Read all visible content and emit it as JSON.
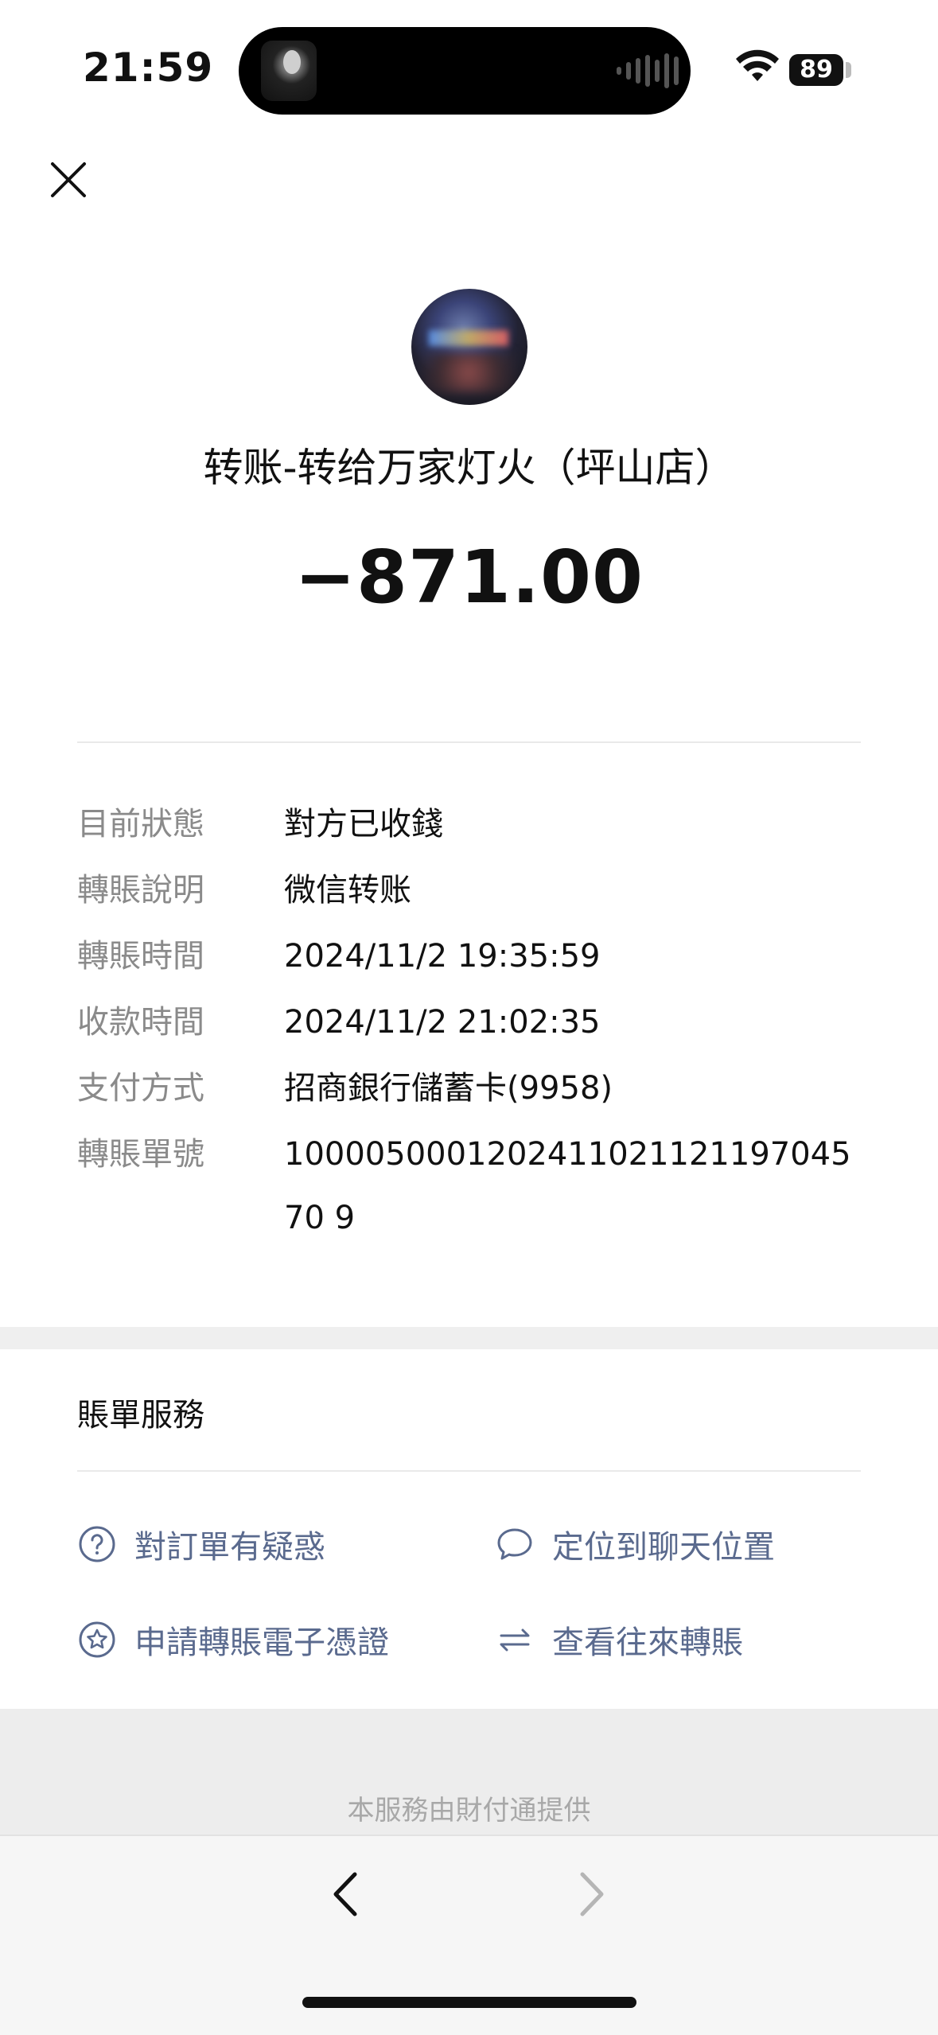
{
  "status_bar": {
    "time": "21:59",
    "battery": "89"
  },
  "header": {
    "close_icon": "close-icon"
  },
  "transaction": {
    "title": "转账-转给万家灯火（坪山店）",
    "amount": "−871.00"
  },
  "details": [
    {
      "label": "目前狀態",
      "value": "對方已收錢"
    },
    {
      "label": "轉賬說明",
      "value": "微信转账"
    },
    {
      "label": "轉賬時間",
      "value": "2024/11/2 19:35:59"
    },
    {
      "label": "收款時間",
      "value": "2024/11/2 21:02:35"
    },
    {
      "label": "支付方式",
      "value": "招商銀行儲蓄卡(9958)"
    },
    {
      "label": "轉賬單號",
      "value": "100005000120241102112119704570 9"
    }
  ],
  "services": {
    "title": "賬單服務",
    "items": [
      {
        "label": "對訂單有疑惑",
        "icon": "question-circle-icon"
      },
      {
        "label": "定位到聊天位置",
        "icon": "chat-bubble-icon"
      },
      {
        "label": "申請轉賬電子憑證",
        "icon": "star-circle-icon"
      },
      {
        "label": "查看往來轉賬",
        "icon": "swap-arrows-icon"
      }
    ]
  },
  "footer": {
    "provider_text": "本服務由財付通提供"
  },
  "colors": {
    "link": "#5a6a8e",
    "label_gray": "#8a8a8a",
    "text": "#111111"
  }
}
